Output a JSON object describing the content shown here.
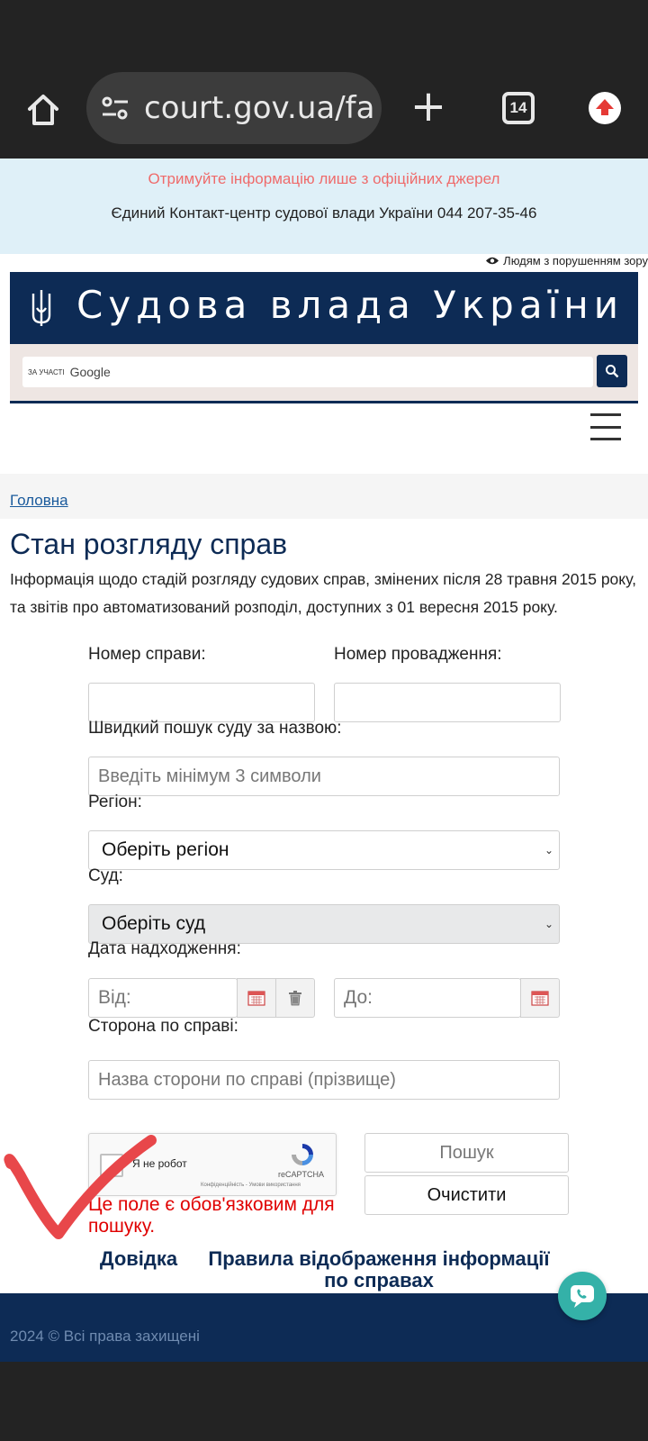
{
  "browser": {
    "url": "court.gov.ua/fa",
    "tab_count": "14"
  },
  "notice": {
    "warning": "Отримуйте інформацію лише з офіційних джерел",
    "contact": "Єдиний Контакт-центр судової влади України 044 207-35-46"
  },
  "accessibility_link": "Людям з порушенням зору",
  "brand": {
    "title": "Судова влада України"
  },
  "search": {
    "by_label": "ЗА УЧАСТІ",
    "google_label": "Google"
  },
  "breadcrumb": {
    "home": "Головна"
  },
  "page": {
    "title": "Стан розгляду справ",
    "intro": "Інформація щодо стадій розгляду судових справ, змінених після 28 травня 2015 року, та звітів про автоматизований розподіл, доступних з 01 вересня 2015 року."
  },
  "form": {
    "case_number_label": "Номер справи:",
    "proceeding_number_label": "Номер провадження:",
    "court_search_label": "Швидкий пошук суду за назвою:",
    "court_search_placeholder": "Введіть мінімум 3 символи",
    "region_label": "Регіон:",
    "region_value": "Оберіть регіон",
    "court_label": "Суд:",
    "court_value": "Оберіть суд",
    "date_label": "Дата надходження:",
    "date_from_placeholder": "Від:",
    "date_to_placeholder": "До:",
    "party_label": "Сторона по справі:",
    "party_placeholder": "Назва сторони по справі (прізвище)",
    "recaptcha_label": "Я не робот",
    "recaptcha_brand": "reCAPTCHA",
    "recaptcha_terms": "Конфіденційність - Умови використання",
    "search_button": "Пошук",
    "clear_button": "Очистити",
    "error": "Це поле є обов'язковим для пошуку."
  },
  "links": {
    "help": "Довідка",
    "rules": "Правила відображення інформації по справах"
  },
  "footer": {
    "copyright": "2024 © Всі права захищені"
  },
  "colors": {
    "brand_navy": "#0d2b55",
    "notice_bg": "#dff0f8",
    "error_red": "#e00000",
    "chat_teal": "#34b1a8",
    "annotation_red": "#e8474a"
  }
}
